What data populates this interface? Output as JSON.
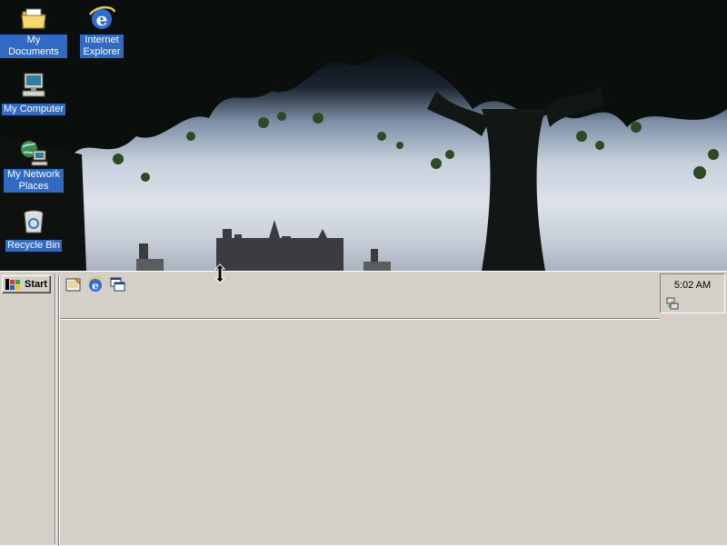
{
  "desktop": {
    "icons": [
      {
        "label": "My Documents",
        "icon": "folder-documents-icon"
      },
      {
        "label": "Internet Explorer",
        "icon": "internet-explorer-icon"
      },
      {
        "label": "My Computer",
        "icon": "my-computer-icon"
      },
      {
        "label": "My Network Places",
        "icon": "network-places-icon"
      },
      {
        "label": "Recycle Bin",
        "icon": "recycle-bin-icon"
      }
    ],
    "label_bg": "#316ac5"
  },
  "taskbar": {
    "start_label": "Start",
    "quick_launch": [
      "show-desktop-icon",
      "internet-explorer-icon",
      "switch-windows-icon"
    ],
    "clock": "5:02 AM",
    "tray_icons": [
      "network-connection-icon"
    ],
    "background": "#d4d0c8"
  },
  "cursor": "resize-vertical-cursor"
}
